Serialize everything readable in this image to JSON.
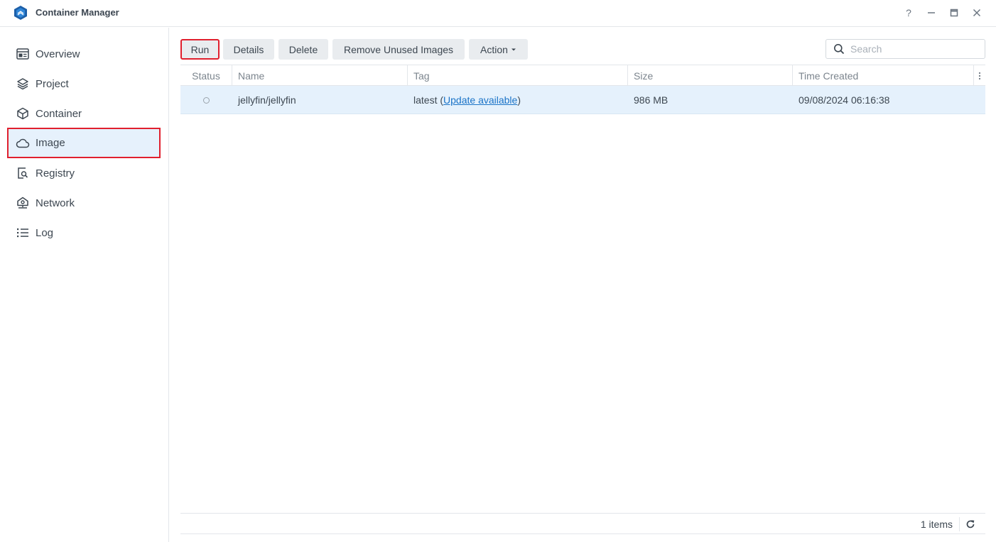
{
  "window": {
    "title": "Container Manager",
    "buttons": {
      "help": "?",
      "minimize": "—",
      "maximize": "▭",
      "close": "✕"
    }
  },
  "sidebar": {
    "items": [
      {
        "label": "Overview",
        "icon": "overview-icon"
      },
      {
        "label": "Project",
        "icon": "layers-icon"
      },
      {
        "label": "Container",
        "icon": "cube-icon"
      },
      {
        "label": "Image",
        "icon": "cloud-icon",
        "active": true
      },
      {
        "label": "Registry",
        "icon": "registry-search-icon"
      },
      {
        "label": "Network",
        "icon": "network-icon"
      },
      {
        "label": "Log",
        "icon": "list-icon"
      }
    ]
  },
  "toolbar": {
    "run": "Run",
    "details": "Details",
    "delete": "Delete",
    "remove_unused": "Remove Unused Images",
    "action": "Action"
  },
  "search": {
    "placeholder": "Search"
  },
  "table": {
    "columns": [
      "Status",
      "Name",
      "Tag",
      "Size",
      "Time Created"
    ],
    "rows": [
      {
        "status": "stopped",
        "name": "jellyfin/jellyfin",
        "tag": "latest",
        "tag_prefix": "(",
        "tag_link": "Update available",
        "tag_suffix": ")",
        "size": "986 MB",
        "created": "09/08/2024 06:16:38"
      }
    ]
  },
  "footer": {
    "count": "1 items"
  },
  "colors": {
    "accent": "#1a73c7",
    "highlight_border": "#e0202e",
    "selected_row": "#e5f1fc"
  }
}
